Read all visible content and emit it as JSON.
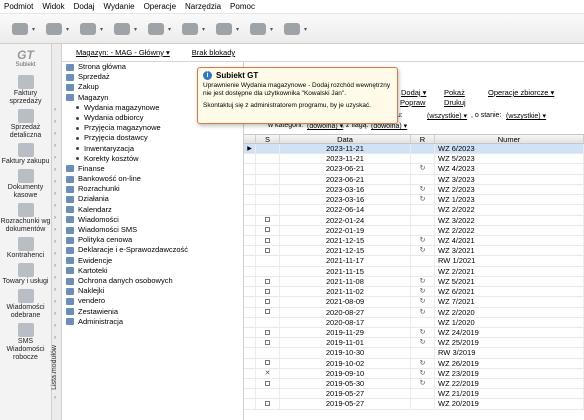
{
  "menu": [
    "Podmiot",
    "Widok",
    "Dodaj",
    "Wydanie",
    "Operacje",
    "Narzędzia",
    "Pomoc"
  ],
  "toolbar_icons": [
    "edit-icon",
    "printer-icon",
    "printer-icon",
    "document-icon",
    "send-icon",
    "copy-icon",
    "send-icon",
    "copy-icon",
    "help-icon"
  ],
  "logo": {
    "title": "GT",
    "subtitle": "Subiekt"
  },
  "left_items": [
    {
      "label": "Faktury sprzedaży",
      "icon": "invoice-icon"
    },
    {
      "label": "Sprzedaż detaliczna",
      "icon": "cash-register-icon"
    },
    {
      "label": "Faktury zakupu",
      "icon": "truck-icon"
    },
    {
      "label": "Dokumenty kasowe",
      "icon": "cash-icon"
    },
    {
      "label": "Rozrachunki wg dokumentów",
      "icon": "settlements-icon"
    },
    {
      "label": "Kontrahenci",
      "icon": "contacts-icon"
    },
    {
      "label": "Towary i usługi",
      "icon": "products-icon"
    },
    {
      "label": "Wiadomości odebrane",
      "icon": "mail-icon"
    },
    {
      "label": "SMS Wiadomości robocze",
      "icon": "sms-icon"
    }
  ],
  "vertical_tab": "Lista modułów",
  "top": {
    "magazyn": "Magazyn: - MAG - Główny ▾",
    "brak": "Brak blokady"
  },
  "nav_items": [
    {
      "label": "Strona główna",
      "sub": false
    },
    {
      "label": "Sprzedaż",
      "sub": false
    },
    {
      "label": "Zakup",
      "sub": false
    },
    {
      "label": "Magazyn",
      "sub": false
    },
    {
      "label": "Wydania magazynowe",
      "sub": true
    },
    {
      "label": "Wydania odbiorcy",
      "sub": true
    },
    {
      "label": "Przyjęcia magazynowe",
      "sub": true
    },
    {
      "label": "Przyjęcia dostawcy",
      "sub": true
    },
    {
      "label": "Inwentaryzacja",
      "sub": true
    },
    {
      "label": "Korekty kosztów",
      "sub": true
    },
    {
      "label": "Finanse",
      "sub": false
    },
    {
      "label": "Bankowość on-line",
      "sub": false
    },
    {
      "label": "Rozrachunki",
      "sub": false
    },
    {
      "label": "Działania",
      "sub": false
    },
    {
      "label": "Kalendarz",
      "sub": false
    },
    {
      "label": "Wiadomości",
      "sub": false
    },
    {
      "label": "Wiadomości SMS",
      "sub": false
    },
    {
      "label": "Polityka cenowa",
      "sub": false
    },
    {
      "label": "Deklaracje i e-Sprawozdawczość",
      "sub": false
    },
    {
      "label": "Ewidencje",
      "sub": false
    },
    {
      "label": "Kartoteki",
      "sub": false
    },
    {
      "label": "Ochrona danych osobowych",
      "sub": false
    },
    {
      "label": "Naklejki",
      "sub": false
    },
    {
      "label": "vendero",
      "sub": false
    },
    {
      "label": "Zestawienia",
      "sub": false
    },
    {
      "label": "Administracja",
      "sub": false
    }
  ],
  "actions": {
    "dodaj": "Dodaj ▾",
    "pokaz": "Pokaż",
    "operacje": "Operacje zbiorcze ▾",
    "popraw": "Popraw",
    "drukuj": "Drukuj"
  },
  "filter": {
    "typu_label": "pu:",
    "typu_val": "(wszystkie) ▾",
    "stan_label": ", o stanie:",
    "stan_val": "(wszystkie) ▾",
    "kat_label": "w kategorii:",
    "kat_val": "(dowolna) ▾",
    "flaga_label": ", z flagą:",
    "flaga_val": "(dowolna) ▾"
  },
  "grid": {
    "headers": [
      "",
      "S",
      "Data",
      "R",
      "Numer"
    ],
    "rows": [
      {
        "marker": "▶",
        "s": "",
        "date": "2023-11-21",
        "r": "",
        "num": "WZ 6/2023",
        "sel": true
      },
      {
        "marker": "",
        "s": "",
        "date": "2023-11-21",
        "r": "",
        "num": "WZ 5/2023",
        "sel": false
      },
      {
        "marker": "",
        "s": "",
        "date": "2023-06-21",
        "r": "↻",
        "num": "WZ 4/2023",
        "sel": false
      },
      {
        "marker": "",
        "s": "",
        "date": "2023-06-21",
        "r": "",
        "num": "WZ 3/2023",
        "sel": false
      },
      {
        "marker": "",
        "s": "",
        "date": "2023-03-16",
        "r": "↻",
        "num": "WZ 2/2023",
        "sel": false
      },
      {
        "marker": "",
        "s": "",
        "date": "2023-03-16",
        "r": "↻",
        "num": "WZ 1/2023",
        "sel": false
      },
      {
        "marker": "",
        "s": "",
        "date": "2022-06-14",
        "r": "",
        "num": "WZ 2/2022",
        "sel": false
      },
      {
        "marker": "",
        "s": "box",
        "date": "2022-01-24",
        "r": "",
        "num": "WZ 3/2022",
        "sel": false
      },
      {
        "marker": "",
        "s": "box",
        "date": "2022-01-19",
        "r": "",
        "num": "WZ 2/2022",
        "sel": false
      },
      {
        "marker": "",
        "s": "box",
        "date": "2021-12-15",
        "r": "↻",
        "num": "WZ 4/2021",
        "sel": false
      },
      {
        "marker": "",
        "s": "box",
        "date": "2021-12-15",
        "r": "↻",
        "num": "WZ 3/2021",
        "sel": false
      },
      {
        "marker": "",
        "s": "",
        "date": "2021-11-17",
        "r": "",
        "num": "RW 1/2021",
        "sel": false
      },
      {
        "marker": "",
        "s": "",
        "date": "2021-11-15",
        "r": "",
        "num": "WZ 2/2021",
        "sel": false
      },
      {
        "marker": "",
        "s": "box",
        "date": "2021-11-08",
        "r": "↻",
        "num": "WZ 5/2021",
        "sel": false
      },
      {
        "marker": "",
        "s": "box",
        "date": "2021-11-02",
        "r": "↻",
        "num": "WZ 6/2021",
        "sel": false
      },
      {
        "marker": "",
        "s": "box",
        "date": "2021-08-09",
        "r": "↻",
        "num": "WZ 7/2021",
        "sel": false
      },
      {
        "marker": "",
        "s": "box",
        "date": "2020-08-27",
        "r": "↻",
        "num": "WZ 2/2020",
        "sel": false
      },
      {
        "marker": "",
        "s": "",
        "date": "2020-08-17",
        "r": "",
        "num": "WZ 1/2020",
        "sel": false
      },
      {
        "marker": "",
        "s": "box",
        "date": "2019-11-29",
        "r": "↻",
        "num": "WZ 24/2019",
        "sel": false
      },
      {
        "marker": "",
        "s": "box",
        "date": "2019-11-01",
        "r": "↻",
        "num": "WZ 25/2019",
        "sel": false
      },
      {
        "marker": "",
        "s": "",
        "date": "2019-10-30",
        "r": "",
        "num": "RW 3/2019",
        "sel": false
      },
      {
        "marker": "",
        "s": "box",
        "date": "2019-10-02",
        "r": "↻",
        "num": "WZ 26/2019",
        "sel": false
      },
      {
        "marker": "",
        "s": "✕",
        "date": "2019-09-10",
        "r": "↻",
        "num": "WZ 23/2019",
        "sel": false
      },
      {
        "marker": "",
        "s": "box",
        "date": "2019-05-30",
        "r": "↻",
        "num": "WZ 22/2019",
        "sel": false
      },
      {
        "marker": "",
        "s": "",
        "date": "2019-05-27",
        "r": "",
        "num": "WZ 21/2019",
        "sel": false
      },
      {
        "marker": "",
        "s": "box",
        "date": "2019-05-27",
        "r": "",
        "num": "WZ 20/2019",
        "sel": false
      }
    ]
  },
  "dialog": {
    "title": "Subiekt GT",
    "line1": "Uprawnienie Wydania magazynowe - Dodaj rozchód wewnętrzny",
    "line2": "nie jest dostępne dla użytkownika \"Kowalski Jan\".",
    "line3": "Skontaktuj się z administratorem programu, by je uzyskać."
  }
}
